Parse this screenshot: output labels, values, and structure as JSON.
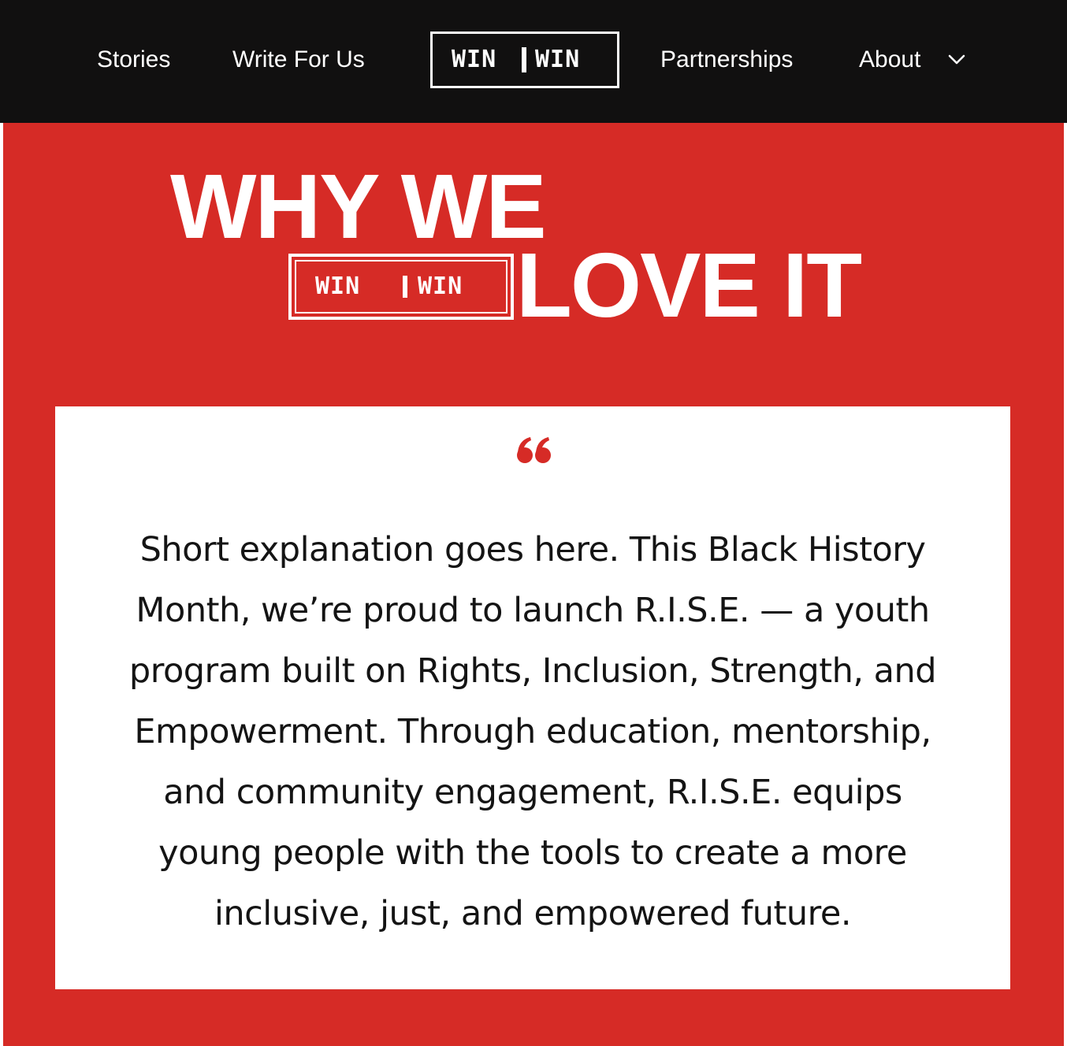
{
  "nav": {
    "items": [
      {
        "label": "Stories"
      },
      {
        "label": "Write For Us"
      },
      {
        "label": "Partnerships"
      },
      {
        "label": "About"
      }
    ],
    "logo": {
      "left": "WIN",
      "right": "WIN"
    },
    "about_icon": "chevron-down-icon"
  },
  "hero": {
    "headline_line1": "WHY WE",
    "headline_line2": "LOVE IT",
    "badge": {
      "left": "WIN",
      "right": "WIN"
    },
    "background_color": "#d62b26"
  },
  "quote": {
    "icon": "quote-icon",
    "text": "Short explanation goes here. This Black History Month, we’re proud to launch R.I.S.E. — a youth program built on Rights, Inclusion, Strength, and Empowerment. Through education, mentorship, and community engagement, R.I.S.E. equips young people with the tools to create a more inclusive, just, and empowered future."
  },
  "colors": {
    "nav_background": "#111010",
    "accent_red": "#d62b26",
    "text_dark": "#141414"
  }
}
